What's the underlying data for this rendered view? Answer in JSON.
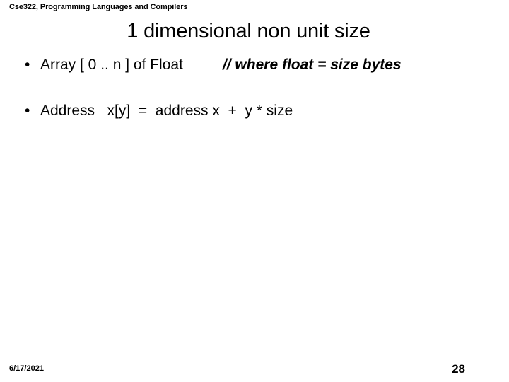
{
  "slide": {
    "header": "Cse322, Programming Languages and Compilers",
    "title": "1 dimensional non unit size",
    "bullets": [
      {
        "marker": "•",
        "text": "Array [ 0 .. n ] of Float",
        "comment": "// where float = size bytes"
      },
      {
        "marker": "•",
        "text": "Address   x[y]  =  address x  +  y * size",
        "comment": ""
      }
    ],
    "footer": {
      "date": "6/17/2021",
      "page_number": "28"
    },
    "colors": {
      "background": "#ffffff",
      "text": "#000000"
    }
  }
}
